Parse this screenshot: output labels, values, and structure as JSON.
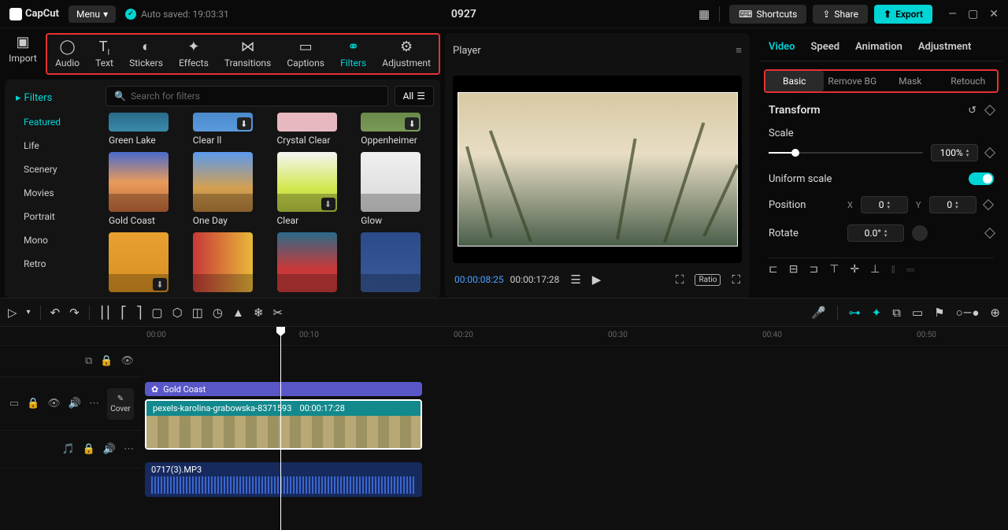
{
  "topbar": {
    "logo": "CapCut",
    "menu": "Menu",
    "auto_saved": "Auto saved: 19:03:31",
    "project_title": "0927",
    "shortcuts": "Shortcuts",
    "share": "Share",
    "export": "Export"
  },
  "lib_tabs": {
    "import": "Import",
    "audio": "Audio",
    "text": "Text",
    "stickers": "Stickers",
    "effects": "Effects",
    "transitions": "Transitions",
    "captions": "Captions",
    "filters": "Filters",
    "adjustment": "Adjustment"
  },
  "filter_sidebar": {
    "filters": "Filters",
    "featured": "Featured",
    "life": "Life",
    "scenery": "Scenery",
    "movies": "Movies",
    "portrait": "Portrait",
    "mono": "Mono",
    "retro": "Retro"
  },
  "search": {
    "placeholder": "Search for filters",
    "all": "All"
  },
  "filters": {
    "green_lake": "Green Lake",
    "clear_ll": "Clear ll",
    "crystal_clear": "Crystal Clear",
    "oppenheimer": "Oppenheimer",
    "gold_coast": "Gold Coast",
    "one_day": "One Day",
    "clear": "Clear",
    "glow": "Glow"
  },
  "player": {
    "title": "Player",
    "current": "00:00:08:25",
    "total": "00:00:17:28",
    "ratio": "Ratio"
  },
  "inspector": {
    "tabs": {
      "video": "Video",
      "speed": "Speed",
      "animation": "Animation",
      "adjustment": "Adjustment"
    },
    "subtabs": {
      "basic": "Basic",
      "remove_bg": "Remove BG",
      "mask": "Mask",
      "retouch": "Retouch"
    },
    "transform": "Transform",
    "scale": "Scale",
    "scale_value": "100%",
    "uniform_scale": "Uniform scale",
    "position": "Position",
    "pos_x_label": "X",
    "pos_x": "0",
    "pos_y_label": "Y",
    "pos_y": "0",
    "rotate": "Rotate",
    "rotate_value": "0.0°"
  },
  "timeline": {
    "ruler": [
      "00:00",
      "00:10",
      "00:20",
      "00:30",
      "00:40",
      "00:50"
    ],
    "filter_clip": "Gold Coast",
    "video_clip_name": "pexels-karolina-grabowska-8371593",
    "video_clip_dur": "00:00:17:28",
    "audio_clip": "0717(3).MP3",
    "cover": "Cover"
  }
}
